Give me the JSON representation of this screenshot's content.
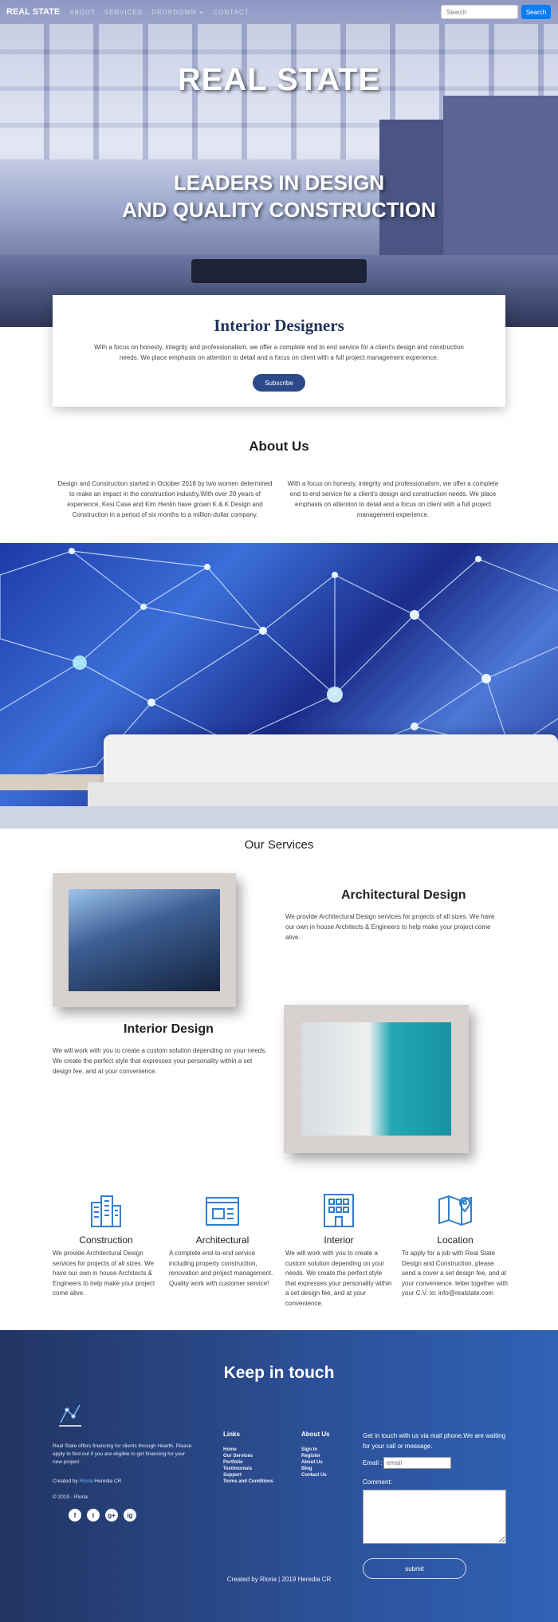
{
  "navbar": {
    "brand": "REAL STATE",
    "links": [
      "ABOUT",
      "SERVICES",
      "DROPDOWN",
      "CONTACT"
    ],
    "search_placeholder": "Search",
    "search_button": "Search"
  },
  "hero": {
    "title": "REAL STATE",
    "subtitle_line1": "LEADERS IN DESIGN",
    "subtitle_line2": "AND QUALITY CONSTRUCTION"
  },
  "intro_card": {
    "title": "Interior Designers",
    "text": "With a focus on honesty, integrity and professionalism, we offer a complete end to end service for a client's design and construction needs. We place emphasis on attention to detail and a focus on client with a full project management experience.",
    "button": "Subscribe"
  },
  "about": {
    "title": "About Us",
    "col1": "Design and Construction started in October 2018 by two women determined to make an impact in the construction industry.With over 20 years of experience, Kesi Case and Kim Henlin have grown K & K Design and Construction in a period of six months to a million-dollar company.",
    "col2": "With a focus on honesty, integrity and professionalism, we offer a complete end to end service for a client's design and construction needs. We place emphasis on attention to detail and a focus on client with a full project management experience."
  },
  "services": {
    "title": "Our Services",
    "architectural": {
      "heading": "Architectural Design",
      "text": "We provide Architectural Design services for projects of all sizes. We have our own in house Architects & Engineers to help make your project come alive."
    },
    "interior": {
      "heading": "Interior Design",
      "text": "We will work with you to create a custom solution depending on your needs. We create the perfect style that expresses your personality within a set design fee, and at your convenience."
    }
  },
  "features": [
    {
      "icon": "buildings-icon",
      "title": "Construction",
      "text": "We provide Architectural Design services for projects of all sizes. We have our own in house Architects & Engineers to help make your project come alive."
    },
    {
      "icon": "blueprint-icon",
      "title": "Architectural",
      "text": "A complete end-to-end service including property construction, renovation and project management. Quality work with customer service!"
    },
    {
      "icon": "building-grid-icon",
      "title": "Interior",
      "text": "We will work with you to create a custom solution depending on your needs. We create the perfect style that expresses your personality within a set design fee, and at your convenience."
    },
    {
      "icon": "map-location-icon",
      "title": "Location",
      "text": "To apply for a job with Real State Design and Construction, please send a cover a set design fee, and at your convenience. letter together with your C.V. to: info@realstate.com"
    }
  ],
  "footer": {
    "title": "Keep in touch",
    "blurb": "Real State offers financing for clients through Hearth. Please apply to find out if you are eligible to get financing for your new project.",
    "credit_prefix": "Created by",
    "credit_link": "Rloria",
    "credit_suffix": "Heredia CR",
    "copyright": "© 2019 - Rloria",
    "social": [
      "f",
      "t",
      "g+",
      "ig"
    ],
    "links_heading": "Links",
    "links": [
      "Home",
      "Our Services",
      "Portfolio",
      "Testimonials",
      "Support",
      "Terms and Conditions"
    ],
    "about_heading": "About Us",
    "about_links": [
      "Sign In",
      "Register",
      "About Us",
      "Blog",
      "Contact Us"
    ],
    "contact_intro": "Get in touch with us via mail phone.We are waiting for your call or message.",
    "email_label": "Email :",
    "email_placeholder": "email",
    "comment_label": "Comment:",
    "submit": "submit",
    "bottom": "Created by Rloria | 2019 Heredia CR"
  },
  "colors": {
    "primary": "#0d7df4",
    "footer_start": "#223563",
    "footer_end": "#2f62b6",
    "card_title": "#24335c",
    "icon_blue": "#2f7fd0"
  }
}
